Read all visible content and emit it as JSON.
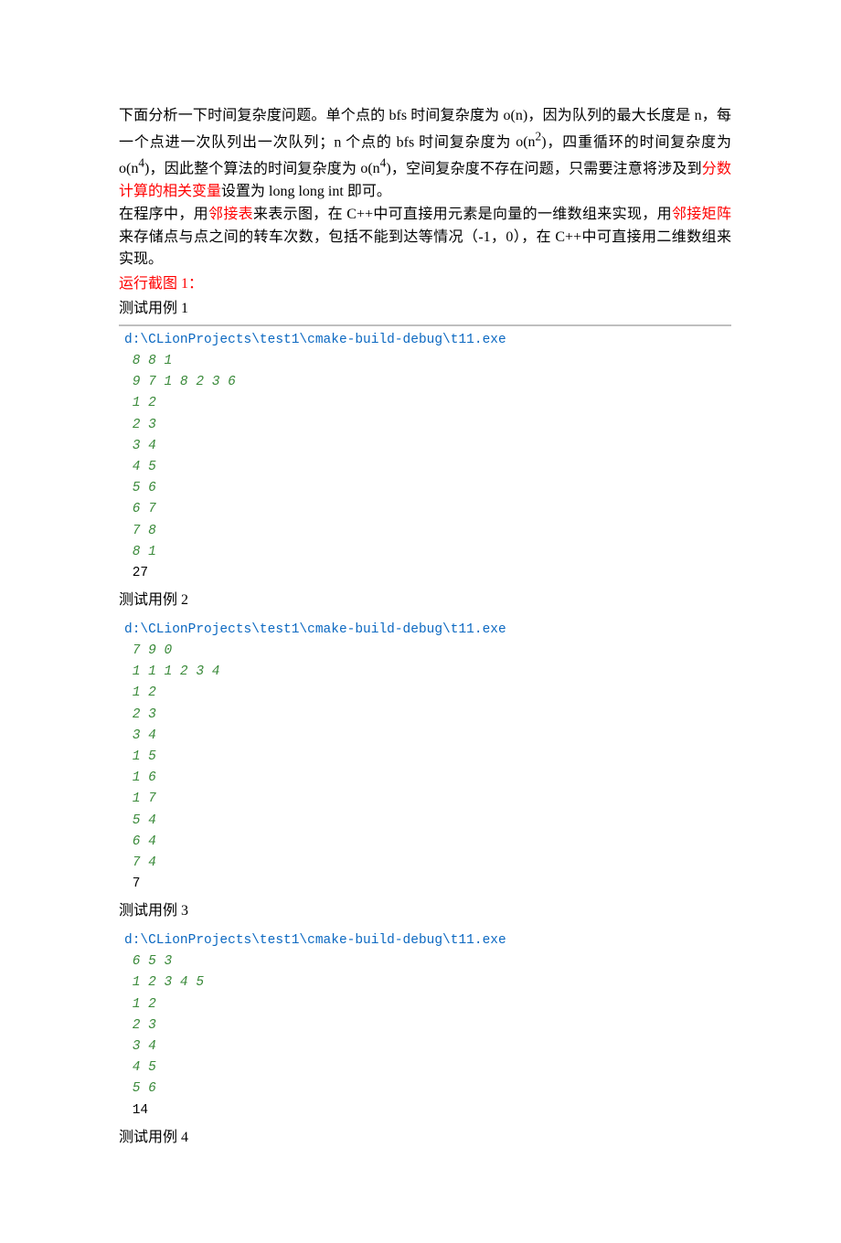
{
  "para1_a": "下面分析一下时间复杂度问题。单个点的 ",
  "para1_b": "bfs",
  "para1_c": " 时间复杂度为 ",
  "para1_d": "o(n)",
  "para1_e": "，因为队列的最大长度是 ",
  "para1_f": "n",
  "para1_g": "，每一个点进一次队列出一次队列；",
  "para1_h": "n",
  "para1_i": " 个点的 ",
  "para1_j": "bfs",
  "para1_k": " 时间复杂度为 ",
  "para1_l": "o(n",
  "para1_m": "2",
  "para1_n": ")",
  "para1_o": "，四重循环的时间复杂度为 ",
  "para1_p": "o(n",
  "para1_q": "4",
  "para1_r": ")",
  "para1_s": "，因此整个算法的时间复杂度为 ",
  "para1_t": "o(n",
  "para1_u": "4",
  "para1_v": ")",
  "para1_w": "，空间复杂度不存在问题，只需要注意将涉及到",
  "para1_x": "分数计算的相关变量",
  "para1_y": "设置为 ",
  "para1_z": "long long int",
  "para1_aa": " 即可。",
  "para2_a": "在程序中，用",
  "para2_b": "邻接表",
  "para2_c": "来表示图，在 ",
  "para2_d": "C++",
  "para2_e": "中可直接用元素是向量的一维数组来实现，用",
  "para2_f": "邻接矩阵",
  "para2_g": "来存储点与点之间的转车次数，包括不能到达等情况（",
  "para2_h": "-1",
  "para2_i": "，",
  "para2_j": "0",
  "para2_k": "），在 ",
  "para2_l": "C++",
  "para2_m": "中可直接用二维数组来实现。",
  "caption": "运行截图 1：",
  "test1_label": "测试用例 1",
  "test2_label": "测试用例 2",
  "test3_label": "测试用例 3",
  "test4_label": "测试用例 4",
  "code1_path": "d:\\CLionProjects\\test1\\cmake-build-debug\\t11.exe",
  "code1_in": " 8 8 1\n 9 7 1 8 2 3 6\n 1 2\n 2 3\n 3 4\n 4 5\n 5 6\n 6 7\n 7 8\n 8 1",
  "code1_out": " 27",
  "code2_path": "d:\\CLionProjects\\test1\\cmake-build-debug\\t11.exe",
  "code2_in": " 7 9 0\n 1 1 1 2 3 4\n 1 2\n 2 3\n 3 4\n 1 5\n 1 6\n 1 7\n 5 4\n 6 4\n 7 4",
  "code2_out": " 7",
  "code3_path": "d:\\CLionProjects\\test1\\cmake-build-debug\\t11.exe",
  "code3_in": " 6 5 3\n 1 2 3 4 5\n 1 2\n 2 3\n 3 4\n 4 5\n 5 6",
  "code3_out": " 14"
}
